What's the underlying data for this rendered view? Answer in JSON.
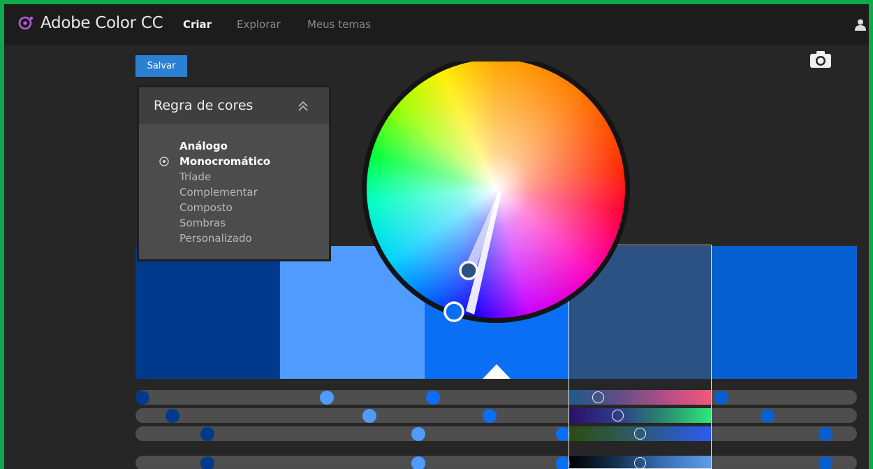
{
  "app": {
    "title": "Adobe Color CC",
    "logo_icon": "adobe-color-logo-icon",
    "logo_color": "#b75bd6"
  },
  "nav": {
    "items": [
      {
        "label": "Criar",
        "active": true
      },
      {
        "label": "Explorar",
        "active": false
      },
      {
        "label": "Meus temas",
        "active": false
      }
    ],
    "user_icon": "user-icon"
  },
  "toolbar": {
    "save_label": "Salvar",
    "camera_icon": "camera-icon"
  },
  "color_rule": {
    "title": "Regra de cores",
    "collapse_icon": "double-chevron-up-icon",
    "selected": "Monocromático",
    "options": [
      "Análogo",
      "Monocromático",
      "Tríade",
      "Complementar",
      "Composto",
      "Sombras",
      "Personalizado"
    ]
  },
  "swatches": {
    "selected_index": 3,
    "base_index": 2,
    "colors": [
      "#003a8c",
      "#4f9bff",
      "#0a6ff5",
      "#2c5283",
      "#0760d2"
    ]
  },
  "sliders": {
    "knob_fractions": [
      [
        0.01,
        0.265,
        0.412,
        0.643,
        0.812
      ],
      [
        0.051,
        0.324,
        0.491,
        0.67,
        0.876
      ],
      [
        0.1,
        0.392,
        0.592,
        0.701,
        0.956
      ],
      [
        0.1,
        0.392,
        0.592,
        0.701,
        0.956
      ]
    ]
  },
  "wheel": {
    "base_marker_color": "#0a6ff5",
    "marker_color": "#2c5283"
  }
}
